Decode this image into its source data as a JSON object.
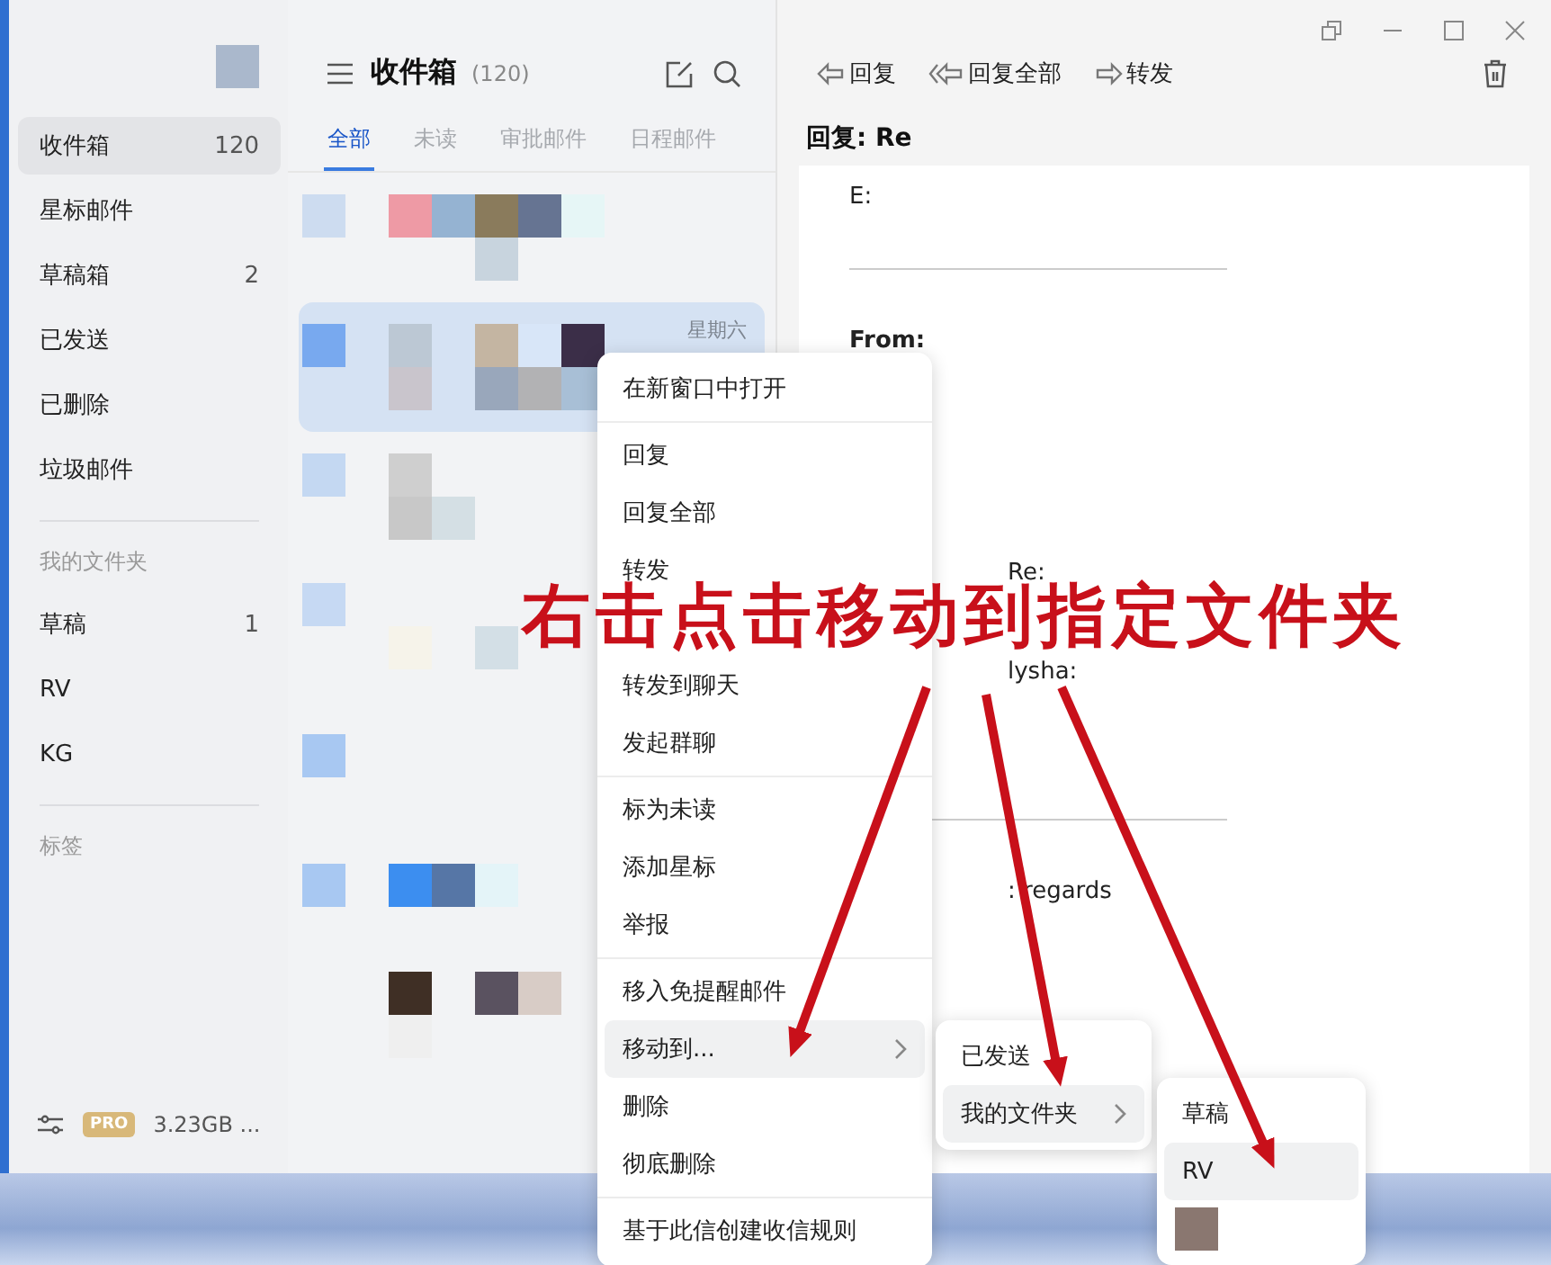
{
  "sidebar": {
    "folders": [
      {
        "label": "收件箱",
        "count": "120",
        "selected": true
      },
      {
        "label": "星标邮件",
        "selected": false
      },
      {
        "label": "草稿箱",
        "count": "2",
        "selected": false
      },
      {
        "label": "已发送",
        "selected": false
      },
      {
        "label": "已删除",
        "selected": false
      },
      {
        "label": "垃圾邮件",
        "selected": false
      }
    ],
    "my_folders_label": "我的文件夹",
    "my_folders": [
      {
        "label": "草稿",
        "count": "1",
        "selected": false
      },
      {
        "label": "RV",
        "selected": false
      },
      {
        "label": "KG",
        "selected": false
      }
    ],
    "tags_label": "标签",
    "storage": {
      "badge": "PRO",
      "text": "3.23GB ..."
    }
  },
  "list": {
    "title": "收件箱",
    "count": "(120)",
    "tabs": [
      {
        "label": "全部",
        "selected": true
      },
      {
        "label": "未读",
        "selected": false
      },
      {
        "label": "审批邮件",
        "selected": false
      },
      {
        "label": "日程邮件",
        "selected": false
      }
    ],
    "rows": [
      {
        "selected": false
      },
      {
        "selected": true,
        "date": "星期六"
      },
      {
        "selected": false
      },
      {
        "selected": false
      },
      {
        "selected": false
      },
      {
        "selected": false
      },
      {
        "selected": false
      }
    ]
  },
  "reader": {
    "toolbar": [
      {
        "label": "回复",
        "kind": "reply"
      },
      {
        "label": "回复全部",
        "kind": "reply_all"
      },
      {
        "label": "转发",
        "kind": "forward"
      }
    ],
    "subject": "回复: Re",
    "body": [
      {
        "kind": "text",
        "text": "E:"
      },
      {
        "kind": "rule"
      },
      {
        "kind": "bold",
        "text": "From:"
      },
      {
        "kind": "tail",
        "text": "Re:"
      },
      {
        "kind": "tail",
        "text": "lysha:"
      },
      {
        "kind": "rule"
      },
      {
        "kind": "tail",
        "text": ": regards"
      }
    ]
  },
  "context_menu": {
    "groups": [
      [
        {
          "kind": "item",
          "label": "在新窗口中打开",
          "selected": false
        }
      ],
      [
        {
          "kind": "item",
          "label": "回复",
          "selected": false
        },
        {
          "kind": "item",
          "label": "回复全部",
          "selected": false
        },
        {
          "kind": "item",
          "label": "转发",
          "selected": false
        },
        {
          "kind": "covered",
          "selected": false
        },
        {
          "kind": "item",
          "label": "转发到聊天",
          "selected": false
        },
        {
          "kind": "item",
          "label": "发起群聊",
          "selected": false
        }
      ],
      [
        {
          "kind": "item",
          "label": "标为未读",
          "selected": false
        },
        {
          "kind": "item",
          "label": "添加星标",
          "selected": false
        },
        {
          "kind": "item",
          "label": "举报",
          "selected": false
        }
      ],
      [
        {
          "kind": "item",
          "label": "移入免提醒邮件",
          "selected": false
        },
        {
          "kind": "item",
          "label": "移动到...",
          "selected": true,
          "submenu": true
        },
        {
          "kind": "item",
          "label": "删除",
          "selected": false
        },
        {
          "kind": "item",
          "label": "彻底删除",
          "selected": false
        }
      ],
      [
        {
          "kind": "item",
          "label": "基于此信创建收信规则",
          "selected": false
        }
      ]
    ]
  },
  "submenu": {
    "items": [
      {
        "kind": "item",
        "label": "已发送",
        "selected": false
      },
      {
        "kind": "item",
        "label": "我的文件夹",
        "selected": true,
        "submenu": true
      }
    ]
  },
  "submenu_2": {
    "items": [
      {
        "kind": "item",
        "label": "草稿",
        "selected": false
      },
      {
        "kind": "item",
        "label": "RV",
        "selected": true
      },
      {
        "kind": "redacted",
        "selected": false
      }
    ]
  },
  "annotation": "右击点击移动到指定文件夹"
}
